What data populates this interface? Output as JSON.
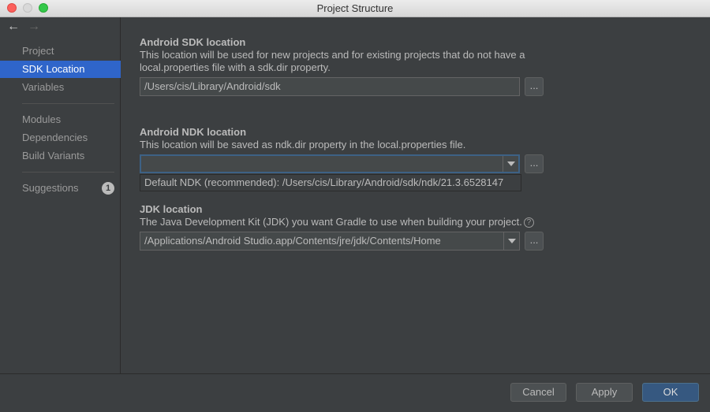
{
  "window": {
    "title": "Project Structure"
  },
  "nav": {
    "back": "←",
    "forward": "→"
  },
  "sidebar": {
    "items": [
      {
        "label": "Project"
      },
      {
        "label": "SDK Location"
      },
      {
        "label": "Variables"
      },
      {
        "label": "Modules"
      },
      {
        "label": "Dependencies"
      },
      {
        "label": "Build Variants"
      },
      {
        "label": "Suggestions",
        "badge": "1"
      }
    ],
    "selected": "SDK Location"
  },
  "sdk": {
    "heading": "Android SDK location",
    "description": "This location will be used for new projects and for existing projects that do not have a local.properties file with a sdk.dir property.",
    "value": "/Users/cis/Library/Android/sdk",
    "browse": "..."
  },
  "ndk": {
    "heading": "Android NDK location",
    "description": "This location will be saved as ndk.dir property in the local.properties file.",
    "value": "",
    "browse": "...",
    "popup_option": "Default NDK (recommended): /Users/cis/Library/Android/sdk/ndk/21.3.6528147"
  },
  "jdk": {
    "heading": "JDK location",
    "description": "The Java Development Kit (JDK) you want Gradle to use when building your project.",
    "help": "?",
    "value": "/Applications/Android Studio.app/Contents/jre/jdk/Contents/Home",
    "browse": "..."
  },
  "footer": {
    "cancel": "Cancel",
    "apply": "Apply",
    "ok": "OK"
  },
  "colors": {
    "selection": "#2f65ca",
    "primary_button": "#365880",
    "background": "#3c3f41"
  }
}
